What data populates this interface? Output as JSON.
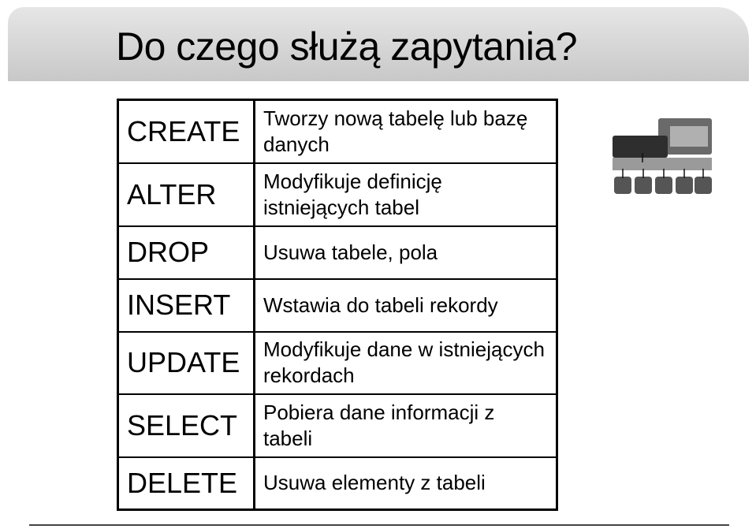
{
  "slide": {
    "title": "Do czego służą zapytania?"
  },
  "table": {
    "rows": [
      {
        "command": "CREATE",
        "description": "Tworzy nową tabelę lub bazę danych"
      },
      {
        "command": "ALTER",
        "description": "Modyfikuje definicję istniejących tabel"
      },
      {
        "command": "DROP",
        "description": "Usuwa tabele, pola"
      },
      {
        "command": "INSERT",
        "description": "Wstawia do tabeli rekordy"
      },
      {
        "command": "UPDATE",
        "description": "Modyfikuje dane w istniejących rekordach"
      },
      {
        "command": "SELECT",
        "description": "Pobiera dane informacji z tabeli"
      },
      {
        "command": "DELETE",
        "description": "Usuwa elementy z tabeli"
      }
    ]
  },
  "diagram": {
    "icon": "database-architecture-diagram"
  }
}
